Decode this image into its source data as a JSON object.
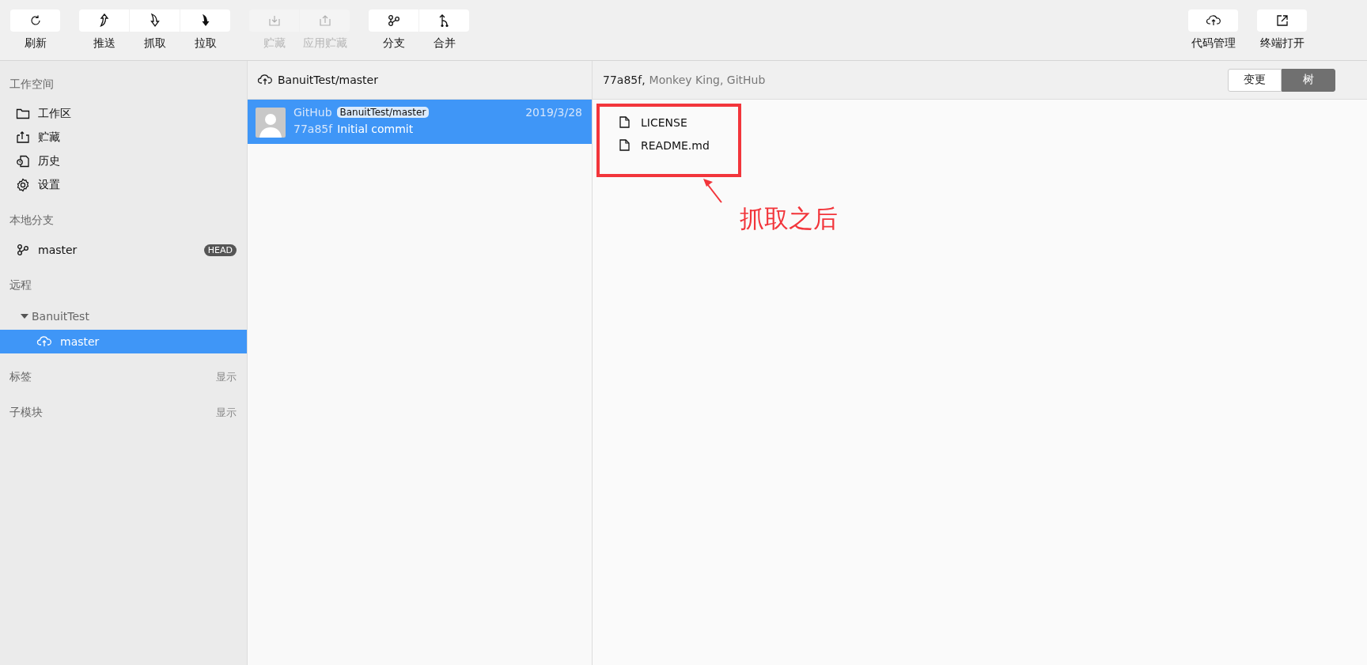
{
  "toolbar": {
    "groups": [
      {
        "buttons": [
          {
            "label": "刷新",
            "kind": "refresh",
            "disabled": false
          }
        ]
      },
      {
        "buttons": [
          {
            "label": "推送",
            "kind": "push",
            "disabled": false
          },
          {
            "label": "抓取",
            "kind": "fetch",
            "disabled": false
          },
          {
            "label": "拉取",
            "kind": "pull",
            "disabled": false
          }
        ]
      },
      {
        "buttons": [
          {
            "label": "贮藏",
            "kind": "stash",
            "disabled": true
          },
          {
            "label": "应用贮藏",
            "kind": "unstash",
            "disabled": true
          }
        ]
      },
      {
        "buttons": [
          {
            "label": "分支",
            "kind": "branch",
            "disabled": false
          },
          {
            "label": "合并",
            "kind": "merge",
            "disabled": false
          }
        ]
      }
    ],
    "right_buttons": [
      {
        "label": "代码管理",
        "kind": "cloud",
        "disabled": false
      },
      {
        "label": "终端打开",
        "kind": "external",
        "disabled": false
      }
    ]
  },
  "sidebar": {
    "sections": [
      {
        "title": "工作空间",
        "kind": "workspace",
        "items": [
          {
            "label": "工作区",
            "kind": "folder",
            "selected": false
          },
          {
            "label": "贮藏",
            "kind": "stash",
            "selected": false
          },
          {
            "label": "历史",
            "kind": "history",
            "selected": false
          },
          {
            "label": "设置",
            "kind": "gear",
            "selected": false
          }
        ]
      },
      {
        "title": "本地分支",
        "kind": "branches",
        "items": [
          {
            "label": "master",
            "kind": "branch",
            "badge": "HEAD",
            "selected": false
          }
        ]
      },
      {
        "title": "远程",
        "kind": "remotes",
        "remotes": [
          {
            "name": "BanuitTest",
            "expanded": true,
            "children": [
              {
                "label": "master",
                "kind": "cloud",
                "selected": true
              }
            ]
          }
        ]
      },
      {
        "title": "标签",
        "kind": "toggle",
        "action": "显示"
      },
      {
        "title": "子模块",
        "kind": "toggle",
        "action": "显示"
      }
    ]
  },
  "commit_list": {
    "header": "BanuitTest/master",
    "commits": [
      {
        "author": "GitHub",
        "ref": "BanuitTest/master",
        "date": "2019/3/28",
        "hash": "77a85f",
        "message": "Initial commit",
        "selected": true
      }
    ]
  },
  "detail": {
    "hash": "77a85f,",
    "info": "Monkey King, GitHub",
    "view_tabs": [
      {
        "label": "变更",
        "selected": false
      },
      {
        "label": "树",
        "selected": true
      }
    ],
    "files": [
      "LICENSE",
      "README.md"
    ]
  },
  "annotation": {
    "text": "抓取之后"
  }
}
